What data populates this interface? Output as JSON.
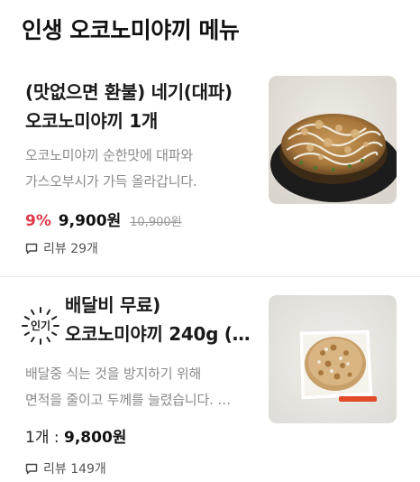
{
  "section_title": "인생 오코노미야끼 메뉴",
  "items": [
    {
      "name_line1": "(맛없으면 환불) 네기(대파)",
      "name_line2": "오코노미야끼 1개",
      "desc_line1": "오코노미야끼 순한맛에 대파와",
      "desc_line2": "가스오부시가 가득 올라갑니다.",
      "discount": "9%",
      "price": "9,900원",
      "original_price": "10,900원",
      "reviews": "리뷰 29개",
      "image_icon": "okonomiyaki-negi-photo"
    },
    {
      "badge": "인기",
      "name_line1": "배달비 무료)",
      "name_line2": "오코노미야끼 240g (…",
      "desc_line1": "배달중 식는 것을 방지하기 위해",
      "desc_line2": "면적을 줄이고 두께를 늘렸습니다. …",
      "qty_label": "1개 : ",
      "price": "9,800원",
      "reviews": "리뷰 149개",
      "image_icon": "okonomiyaki-box-photo"
    }
  ],
  "colors": {
    "discount": "#e0394b",
    "text_dark": "#111111",
    "text_muted": "#8a8a8a"
  }
}
